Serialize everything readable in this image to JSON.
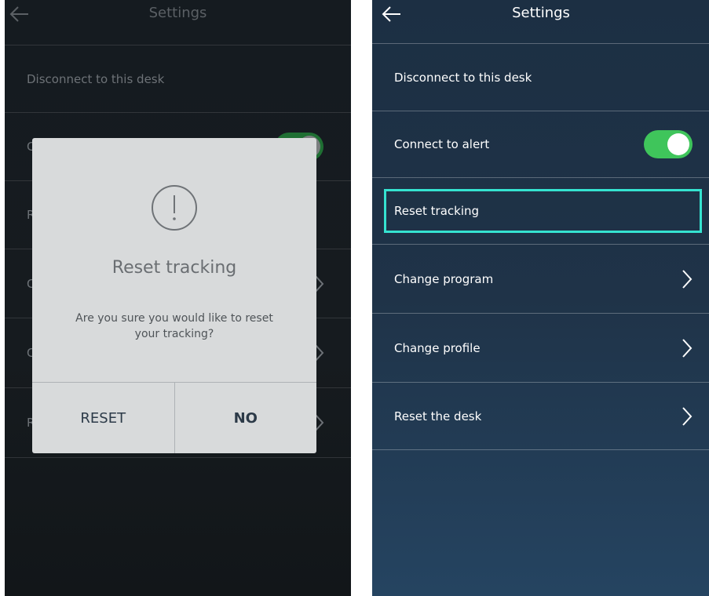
{
  "left_screen": {
    "header": {
      "title": "Settings"
    },
    "rows": [
      {
        "label": "Disconnect to this desk"
      },
      {
        "label": "Co"
      },
      {
        "label": "Re"
      },
      {
        "label": "Cl"
      },
      {
        "label": "Cl"
      },
      {
        "label": "Re"
      }
    ],
    "dialog": {
      "title": "Reset tracking",
      "message": "Are you sure you would like to reset your tracking?",
      "reset_label": "RESET",
      "no_label": "NO"
    }
  },
  "right_screen": {
    "header": {
      "title": "Settings"
    },
    "rows": [
      {
        "label": "Disconnect to this desk"
      },
      {
        "label": "Connect to alert",
        "toggle_on": true
      },
      {
        "label": "Reset tracking",
        "highlighted": true
      },
      {
        "label": "Change program"
      },
      {
        "label": "Change profile"
      },
      {
        "label": "Reset the desk"
      }
    ]
  },
  "colors": {
    "accent_highlight": "#35e3d0",
    "toggle_on": "#3fc55b",
    "right_background": "#1f3348",
    "left_background": "#151b20"
  }
}
